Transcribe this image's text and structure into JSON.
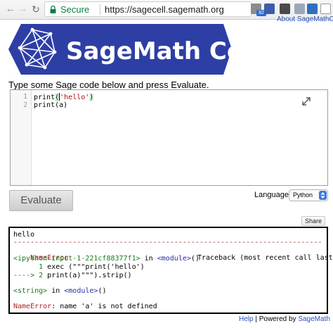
{
  "browser": {
    "secure_label": "Secure",
    "url": "https://sagecell.sagemath.org",
    "extension_badge": "82"
  },
  "header": {
    "about_link": "About SageMathC",
    "logo_text": "SageMath Cell"
  },
  "intro_text": "Type some Sage code below and press Evaluate.",
  "editor": {
    "line_numbers": [
      "1",
      "2"
    ],
    "lines": [
      {
        "fn": "print",
        "open": "(",
        "str": "'hello'",
        "close": ")"
      },
      {
        "text": "print(a)"
      }
    ]
  },
  "controls": {
    "evaluate_label": "Evaluate",
    "language_label": "Language:",
    "language_value": "Python",
    "share_label": "Share"
  },
  "output": {
    "line1": "hello",
    "rule": "---------------------------------------------------------------------------",
    "error_name": "NameError",
    "traceback_header": "Traceback (most recent call last)",
    "tb_input_file": "<ipython-input-1-221cf88377f1>",
    "tb_in": " in ",
    "tb_module": "<module>",
    "tb_call": "()",
    "tb_line1_num": "      1 ",
    "tb_line1_code": "exec (\"\"\"print('hello')",
    "tb_arrow": "----> 2 ",
    "tb_line2_code": "print(a)\"\"\").strip()",
    "tb_string": "<string>",
    "tb_in2": " in ",
    "tb_module2": "<module>",
    "tb_call2": "()",
    "final_error_name": "NameError",
    "final_error_msg": ": name 'a' is not defined"
  },
  "footer": {
    "help": "Help",
    "sep": " | Powered by ",
    "sagemath": "SageMath"
  }
}
